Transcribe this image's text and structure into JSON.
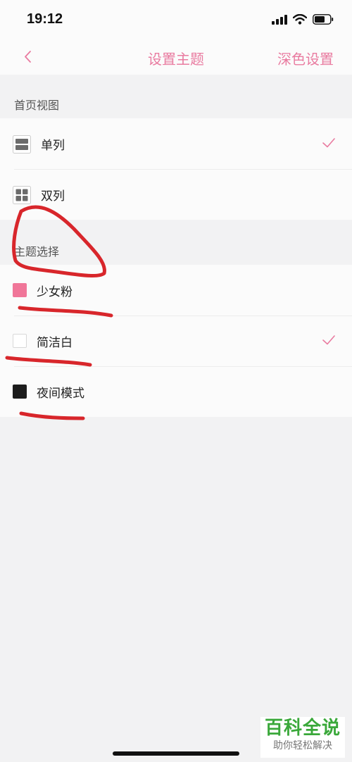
{
  "status": {
    "time": "19:12"
  },
  "nav": {
    "title": "设置主题",
    "right_label": "深色设置"
  },
  "home_view": {
    "header": "首页视图",
    "items": [
      {
        "label": "单列",
        "icon": "single-column-icon",
        "selected": true
      },
      {
        "label": "双列",
        "icon": "grid-icon",
        "selected": false
      }
    ]
  },
  "theme": {
    "header": "主题选择",
    "items": [
      {
        "label": "少女粉",
        "color": "#f07699",
        "selected": false
      },
      {
        "label": "简洁白",
        "color": "#ffffff",
        "selected": true
      },
      {
        "label": "夜间模式",
        "color": "#1c1c1c",
        "selected": false
      }
    ]
  },
  "watermark": {
    "main": "百科全说",
    "sub": "助你轻松解决"
  },
  "colors": {
    "accent": "#e97ba0",
    "annotation": "#d8262b"
  }
}
